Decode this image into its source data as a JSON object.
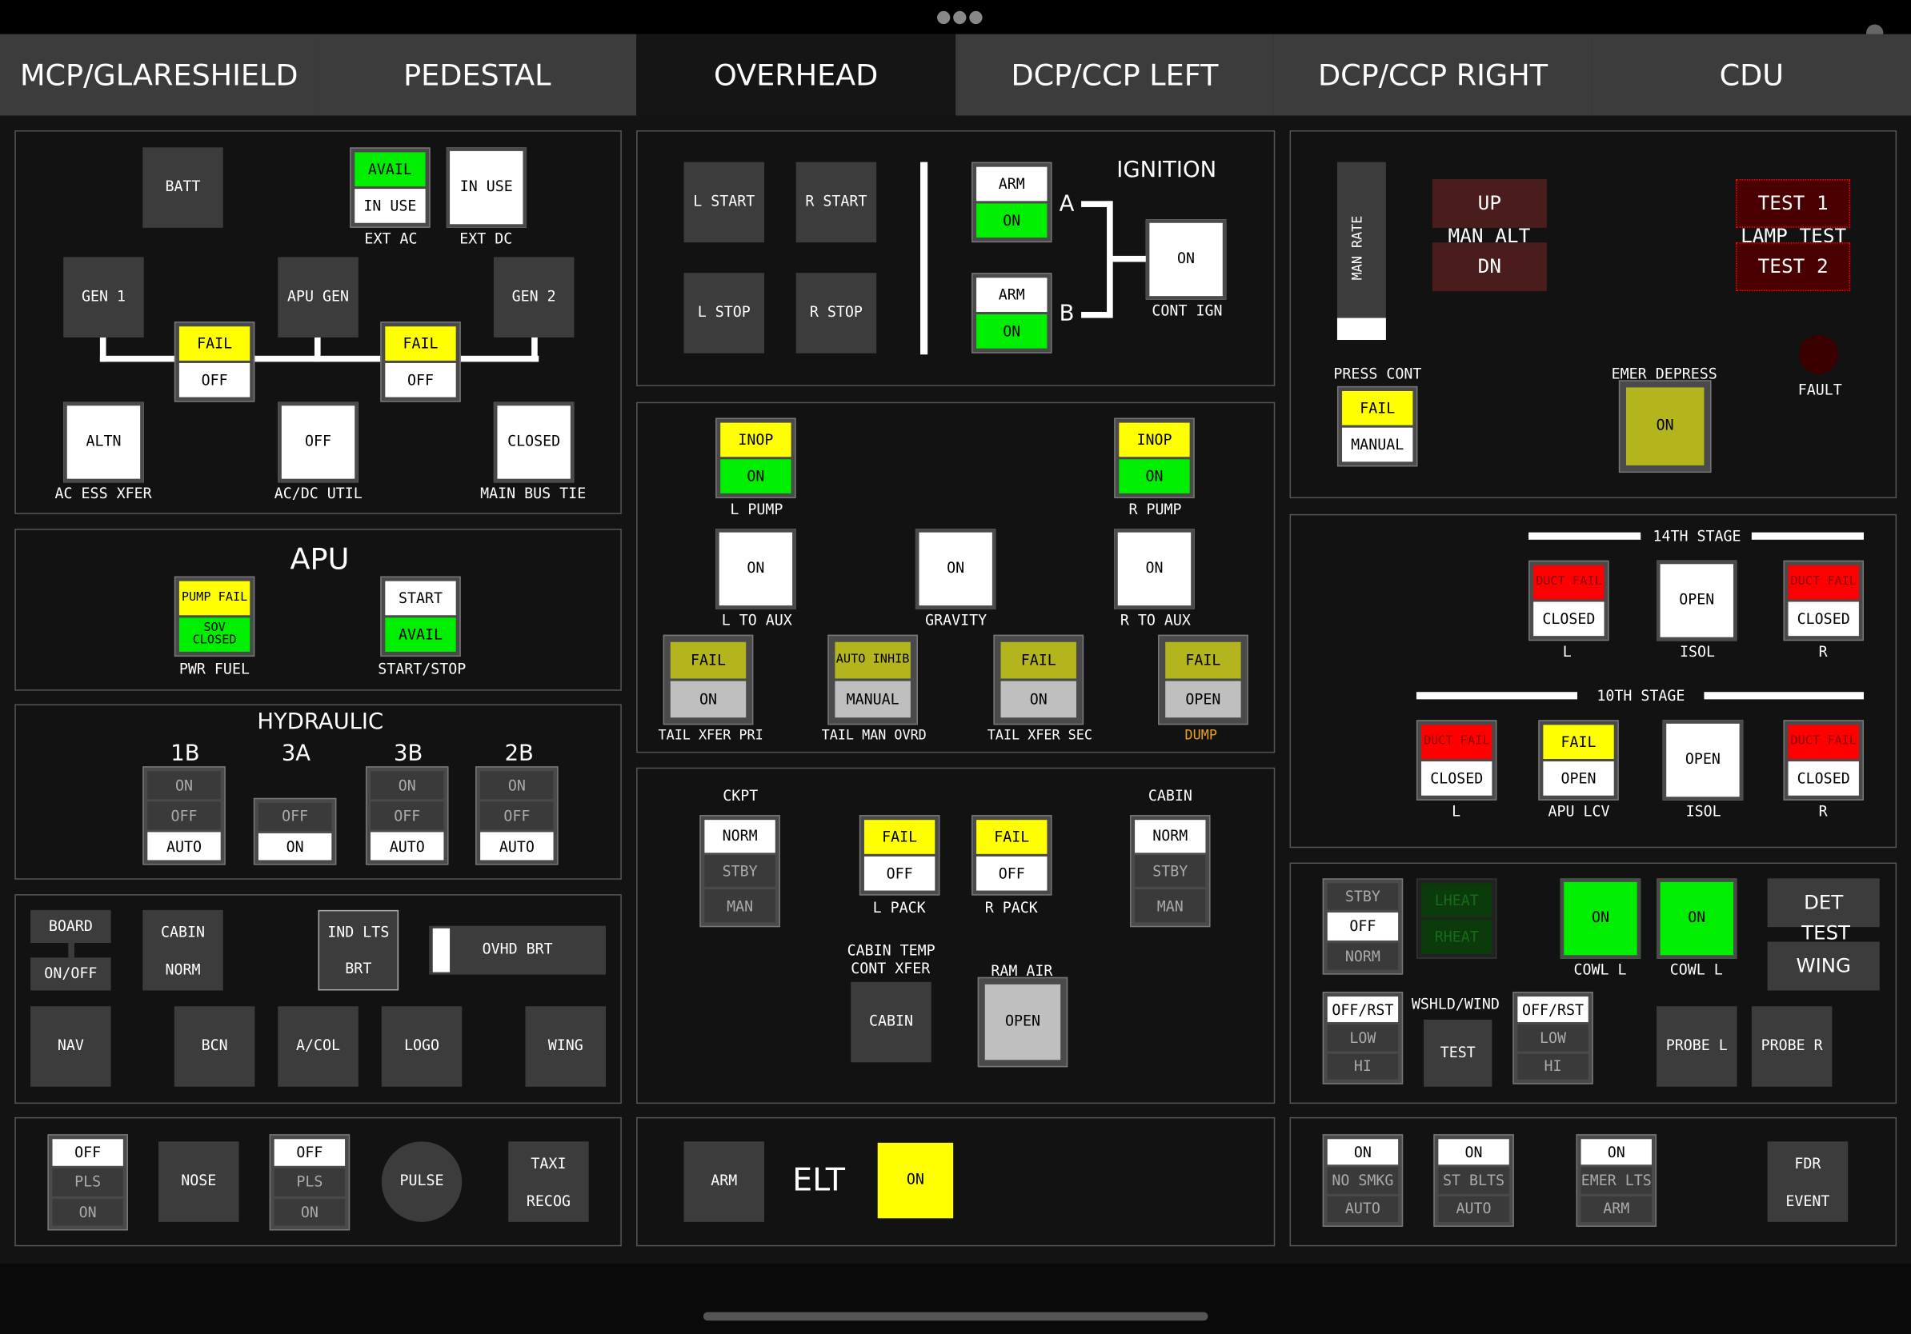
{
  "tabs": [
    "MCP/GLARESHIELD",
    "PEDESTAL",
    "OVERHEAD",
    "DCP/CCP LEFT",
    "DCP/CCP RIGHT",
    "CDU"
  ],
  "active_tab": "OVERHEAD",
  "electrical": {
    "batt": "BATT",
    "ext_ac_avail": "AVAIL",
    "ext_ac_in_use": "IN USE",
    "ext_ac_label": "EXT AC",
    "ext_dc_in_use": "IN USE",
    "ext_dc_label": "EXT DC",
    "gen1": "GEN 1",
    "apu_gen": "APU GEN",
    "gen2": "GEN 2",
    "fail": "FAIL",
    "off": "OFF",
    "altn": "ALTN",
    "ac_ess_xfer": "AC ESS XFER",
    "acdc_off": "OFF",
    "acdc_util": "AC/DC UTIL",
    "closed": "CLOSED",
    "main_bus_tie": "MAIN BUS TIE"
  },
  "apu": {
    "title": "APU",
    "pump_fail": "PUMP FAIL",
    "sov_closed": "SOV CLOSED",
    "pwr_fuel": "PWR FUEL",
    "start": "START",
    "avail": "AVAIL",
    "start_stop": "START/STOP"
  },
  "hydraulic": {
    "title": "HYDRAULIC",
    "h1b": "1B",
    "h3a": "3A",
    "h3b": "3B",
    "h2b": "2B",
    "on": "ON",
    "off": "OFF",
    "auto": "AUTO"
  },
  "lights": {
    "board": "BOARD",
    "on_off": "ON/OFF",
    "cabin": "CABIN",
    "norm": "NORM",
    "ind_lts": "IND LTS",
    "brt": "BRT",
    "ovhd_brt": "OVHD BRT",
    "nav": "NAV",
    "bcn": "BCN",
    "acol": "A/COL",
    "logo": "LOGO",
    "wing": "WING"
  },
  "landing": {
    "off": "OFF",
    "pls": "PLS",
    "on": "ON",
    "nose": "NOSE",
    "pulse": "PULSE",
    "taxi": "TAXI",
    "recog": "RECOG"
  },
  "engine": {
    "l_start": "L START",
    "r_start": "R START",
    "l_stop": "L STOP",
    "r_stop": "R STOP",
    "arm": "ARM",
    "on": "ON",
    "ignition": "IGNITION",
    "a": "A",
    "b": "B",
    "cont_on": "ON",
    "cont_ign": "CONT IGN"
  },
  "fuel": {
    "inop": "INOP",
    "on": "ON",
    "l_pump": "L PUMP",
    "r_pump": "R PUMP",
    "l_to_aux": "L TO AUX",
    "gravity": "GRAVITY",
    "r_to_aux": "R TO AUX",
    "fail": "FAIL",
    "auto_inhib": "AUTO INHIB",
    "manual": "MANUAL",
    "open": "OPEN",
    "tail_xfer_pri": "TAIL XFER PRI",
    "tail_man_ovrd": "TAIL MAN OVRD",
    "tail_xfer_sec": "TAIL XFER SEC",
    "dump": "DUMP"
  },
  "air": {
    "ckpt": "CKPT",
    "cabin": "CABIN",
    "norm": "NORM",
    "stby": "STBY",
    "man": "MAN",
    "fail": "FAIL",
    "off": "OFF",
    "l_pack": "L PACK",
    "r_pack": "R PACK",
    "cabin_temp": "CABIN TEMP",
    "cont_xfer": "CONT XFER",
    "cabin_btn": "CABIN",
    "ram_air": "RAM AIR",
    "open": "OPEN"
  },
  "elt": {
    "arm": "ARM",
    "title": "ELT",
    "on": "ON"
  },
  "pressurization": {
    "man_rate": "MAN RATE",
    "up": "UP",
    "man_alt": "MAN ALT",
    "dn": "DN",
    "test1": "TEST 1",
    "lamp_test": "LAMP TEST",
    "test2": "TEST 2",
    "press_cont": "PRESS CONT",
    "fail": "FAIL",
    "manual": "MANUAL",
    "emer_depress": "EMER DEPRESS",
    "on": "ON",
    "fault": "FAULT"
  },
  "bleed": {
    "stage14": "14TH STAGE",
    "stage10": "10TH STAGE",
    "duct_fail": "DUCT FAIL",
    "closed": "CLOSED",
    "open": "OPEN",
    "fail": "FAIL",
    "l": "L",
    "r": "R",
    "isol": "ISOL",
    "apu_lcv": "APU LCV"
  },
  "ice": {
    "stby": "STBY",
    "off": "OFF",
    "norm": "NORM",
    "lheat": "LHEAT",
    "rheat": "RHEAT",
    "on": "ON",
    "cowl_l": "COWL L",
    "det": "DET",
    "test": "TEST",
    "wing": "WING",
    "off_rst": "OFF/RST",
    "low": "LOW",
    "hi": "HI",
    "wshld_wind": "WSHLD/WIND",
    "test_btn": "TEST",
    "probe_l": "PROBE L",
    "probe_r": "PROBE R"
  },
  "misc": {
    "on": "ON",
    "no_smkg": "NO SMKG",
    "auto": "AUTO",
    "st_blts": "ST BLTS",
    "emer_lts": "EMER LTS",
    "arm": "ARM",
    "fdr": "FDR",
    "event": "EVENT"
  }
}
